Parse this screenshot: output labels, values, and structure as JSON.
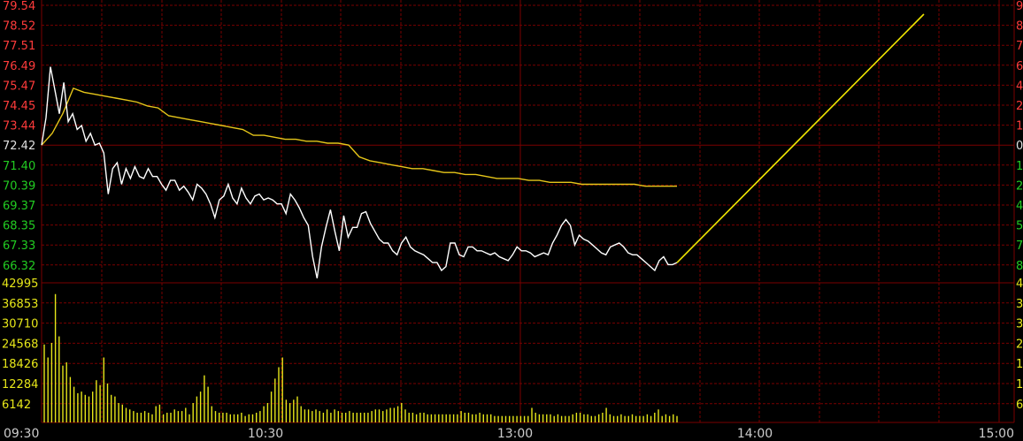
{
  "colors": {
    "background": "#000000",
    "grid": "#7a0000",
    "up": "#ff3b3b",
    "down": "#22cc22",
    "neutral": "#e0e0e0",
    "price_line": "#ffffff",
    "avg_line": "#e6c619",
    "volume": "#e6e619",
    "forecast_line": "#f0e600"
  },
  "chart_data": [
    {
      "type": "line",
      "x_axis": [
        "09:30",
        "10:30",
        "13:00",
        "14:00",
        "15:00"
      ],
      "y_ticks": [
        79.54,
        78.52,
        77.51,
        76.49,
        75.47,
        74.45,
        73.44,
        72.42,
        71.4,
        70.39,
        69.37,
        68.35,
        67.33,
        66.32
      ],
      "y_tick_labels": [
        "79.54",
        "78.52",
        "77.51",
        "76.49",
        "75.47",
        "74.45",
        "73.44",
        "72.42",
        "71.40",
        "70.39",
        "69.37",
        "68.35",
        "67.33",
        "66.32"
      ],
      "ylim": [
        65.3,
        79.54
      ],
      "base_price": 72.42,
      "right_tick_labels": [
        "9",
        "8",
        "7",
        "6",
        "4",
        "2",
        "1",
        "0",
        "1",
        "2",
        "4",
        "5",
        "7",
        "8"
      ],
      "series": [
        {
          "values": [
            72.4,
            73.8,
            76.4,
            75.2,
            74.0,
            75.6,
            73.6,
            74.0,
            73.2,
            73.4,
            72.6,
            73.0,
            72.4,
            72.5,
            72.0,
            69.9,
            71.2,
            71.5,
            70.4,
            71.2,
            70.7,
            71.3,
            70.8,
            70.7,
            71.2,
            70.8,
            70.8,
            70.4,
            70.1,
            70.6,
            70.6,
            70.1,
            70.3,
            70.0,
            69.6,
            70.4,
            70.2,
            69.9,
            69.4,
            68.7,
            69.6,
            69.8,
            70.4,
            69.7,
            69.4,
            70.2,
            69.7,
            69.4,
            69.8,
            69.9,
            69.6,
            69.7,
            69.6,
            69.4,
            69.4,
            68.9,
            69.9,
            69.6,
            69.2,
            68.7,
            68.3,
            66.7,
            65.6,
            67.2,
            68.2,
            69.1,
            68.0,
            67.0,
            68.8,
            67.7,
            68.2,
            68.2,
            68.9,
            69.0,
            68.4,
            68.0,
            67.6,
            67.4,
            67.4,
            67.0,
            66.8,
            67.4,
            67.7,
            67.2,
            67.0,
            66.9,
            66.8,
            66.6,
            66.4,
            66.4,
            66.0,
            66.2,
            67.4,
            67.4,
            66.8,
            66.7,
            67.2,
            67.2,
            67.0,
            67.0,
            66.9,
            66.8,
            66.9,
            66.7,
            66.6,
            66.5,
            66.8,
            67.2,
            67.0,
            67.0,
            66.9,
            66.7,
            66.8,
            66.9,
            66.8,
            67.4,
            67.8,
            68.3,
            68.6,
            68.3,
            67.3,
            67.8,
            67.6,
            67.5,
            67.3,
            67.1,
            66.9,
            66.8,
            67.2,
            67.3,
            67.4,
            67.2,
            66.9,
            66.8,
            66.8,
            66.6,
            66.4,
            66.2,
            66.0,
            66.5,
            66.7,
            66.3,
            66.3,
            66.4
          ],
          "color_key": "price_line"
        },
        {
          "values": [
            72.4,
            73.0,
            74.0,
            75.3,
            75.1,
            75.0,
            74.9,
            74.8,
            74.7,
            74.6,
            74.4,
            74.3,
            73.9,
            73.8,
            73.7,
            73.6,
            73.5,
            73.4,
            73.3,
            73.2,
            72.9,
            72.9,
            72.8,
            72.7,
            72.7,
            72.6,
            72.6,
            72.5,
            72.5,
            72.4,
            71.8,
            71.6,
            71.5,
            71.4,
            71.3,
            71.2,
            71.2,
            71.1,
            71.0,
            71.0,
            70.9,
            70.9,
            70.8,
            70.7,
            70.7,
            70.7,
            70.6,
            70.6,
            70.5,
            70.5,
            70.5,
            70.4,
            70.4,
            70.4,
            70.4,
            70.4,
            70.4,
            70.3,
            70.3,
            70.3,
            70.3
          ],
          "color_key": "avg_line"
        }
      ]
    },
    {
      "type": "bar",
      "y_ticks": [
        42995,
        36853,
        30710,
        24568,
        18426,
        12284,
        6142
      ],
      "y_tick_labels": [
        "42995",
        "36853",
        "30710",
        "24568",
        "18426",
        "12284",
        "6142"
      ],
      "right_tick_labels": [
        "4",
        "3",
        "3",
        "2",
        "1",
        "1",
        "6"
      ],
      "ylim": [
        0,
        42995
      ],
      "values": [
        24000,
        20000,
        24500,
        39500,
        26500,
        17500,
        18500,
        14000,
        11000,
        9000,
        9500,
        8500,
        8000,
        9500,
        13000,
        11500,
        20000,
        12000,
        8500,
        8000,
        6000,
        5500,
        4500,
        4000,
        3500,
        3000,
        3000,
        3500,
        3000,
        2500,
        5000,
        5500,
        2500,
        3000,
        3000,
        4000,
        3500,
        3500,
        4500,
        2500,
        6000,
        8000,
        9500,
        14500,
        11000,
        5000,
        3500,
        3000,
        3000,
        3000,
        2500,
        2500,
        2500,
        3000,
        2000,
        2500,
        2500,
        3000,
        3500,
        5000,
        6000,
        9500,
        13500,
        17000,
        20000,
        7000,
        6000,
        7000,
        8000,
        5000,
        4000,
        4000,
        3500,
        4000,
        3500,
        3000,
        4000,
        3000,
        4000,
        3500,
        3000,
        3000,
        3500,
        3000,
        3000,
        3000,
        3000,
        3000,
        3500,
        4000,
        4000,
        3500,
        4000,
        4500,
        4500,
        5000,
        6000,
        4000,
        3000,
        3000,
        2500,
        3000,
        3000,
        2500,
        2500,
        2500,
        2500,
        2500,
        2500,
        2500,
        2500,
        2500,
        3500,
        3000,
        3000,
        2500,
        2500,
        3000,
        2500,
        2500,
        2500,
        2000,
        2000,
        2000,
        2000,
        2000,
        2000,
        2000,
        2000,
        2000,
        2000,
        4500,
        3000,
        2500,
        2500,
        2500,
        2500,
        2000,
        2500,
        2000,
        2000,
        2000,
        2500,
        3000,
        3000,
        2500,
        2500,
        2000,
        2000,
        2500,
        3000,
        4500,
        2500,
        2000,
        2000,
        2500,
        2000,
        2000,
        2500,
        2000,
        2000,
        2000,
        2500,
        2000,
        3000,
        4000,
        2000,
        2500,
        2000,
        2500,
        2000
      ],
      "color_key": "volume"
    }
  ]
}
